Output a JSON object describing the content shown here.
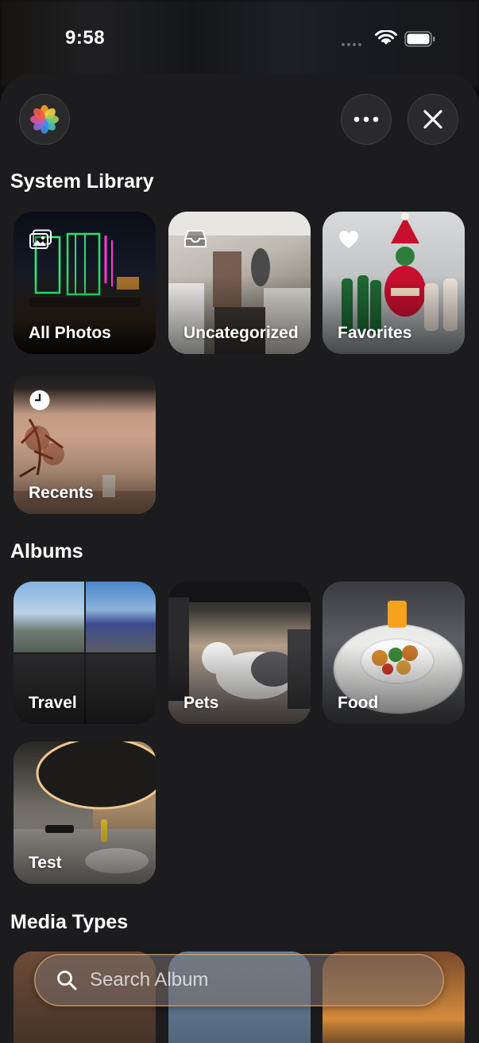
{
  "status_bar": {
    "time": "9:58",
    "icons": [
      "cellular-signal-icon",
      "wifi-icon",
      "battery-icon"
    ]
  },
  "header": {
    "app_icon": "photos-app-icon",
    "more_icon": "ellipsis-icon",
    "close_icon": "close-icon"
  },
  "sections": {
    "system_library": {
      "title": "System Library",
      "items": [
        {
          "label": "All Photos",
          "icon": "photo-stack-icon"
        },
        {
          "label": "Uncategorized",
          "icon": "tray-icon"
        },
        {
          "label": "Favorites",
          "icon": "heart-icon"
        },
        {
          "label": "Recents",
          "icon": "clock-icon"
        }
      ]
    },
    "albums": {
      "title": "Albums",
      "items": [
        {
          "label": "Travel"
        },
        {
          "label": "Pets"
        },
        {
          "label": "Food"
        },
        {
          "label": "Test"
        }
      ]
    },
    "media_types": {
      "title": "Media Types"
    }
  },
  "search": {
    "placeholder": "Search Album",
    "value": "",
    "icon": "search-icon"
  },
  "colors": {
    "sheet_background": "#1c1c1e",
    "search_border": "#f0aa6e"
  }
}
